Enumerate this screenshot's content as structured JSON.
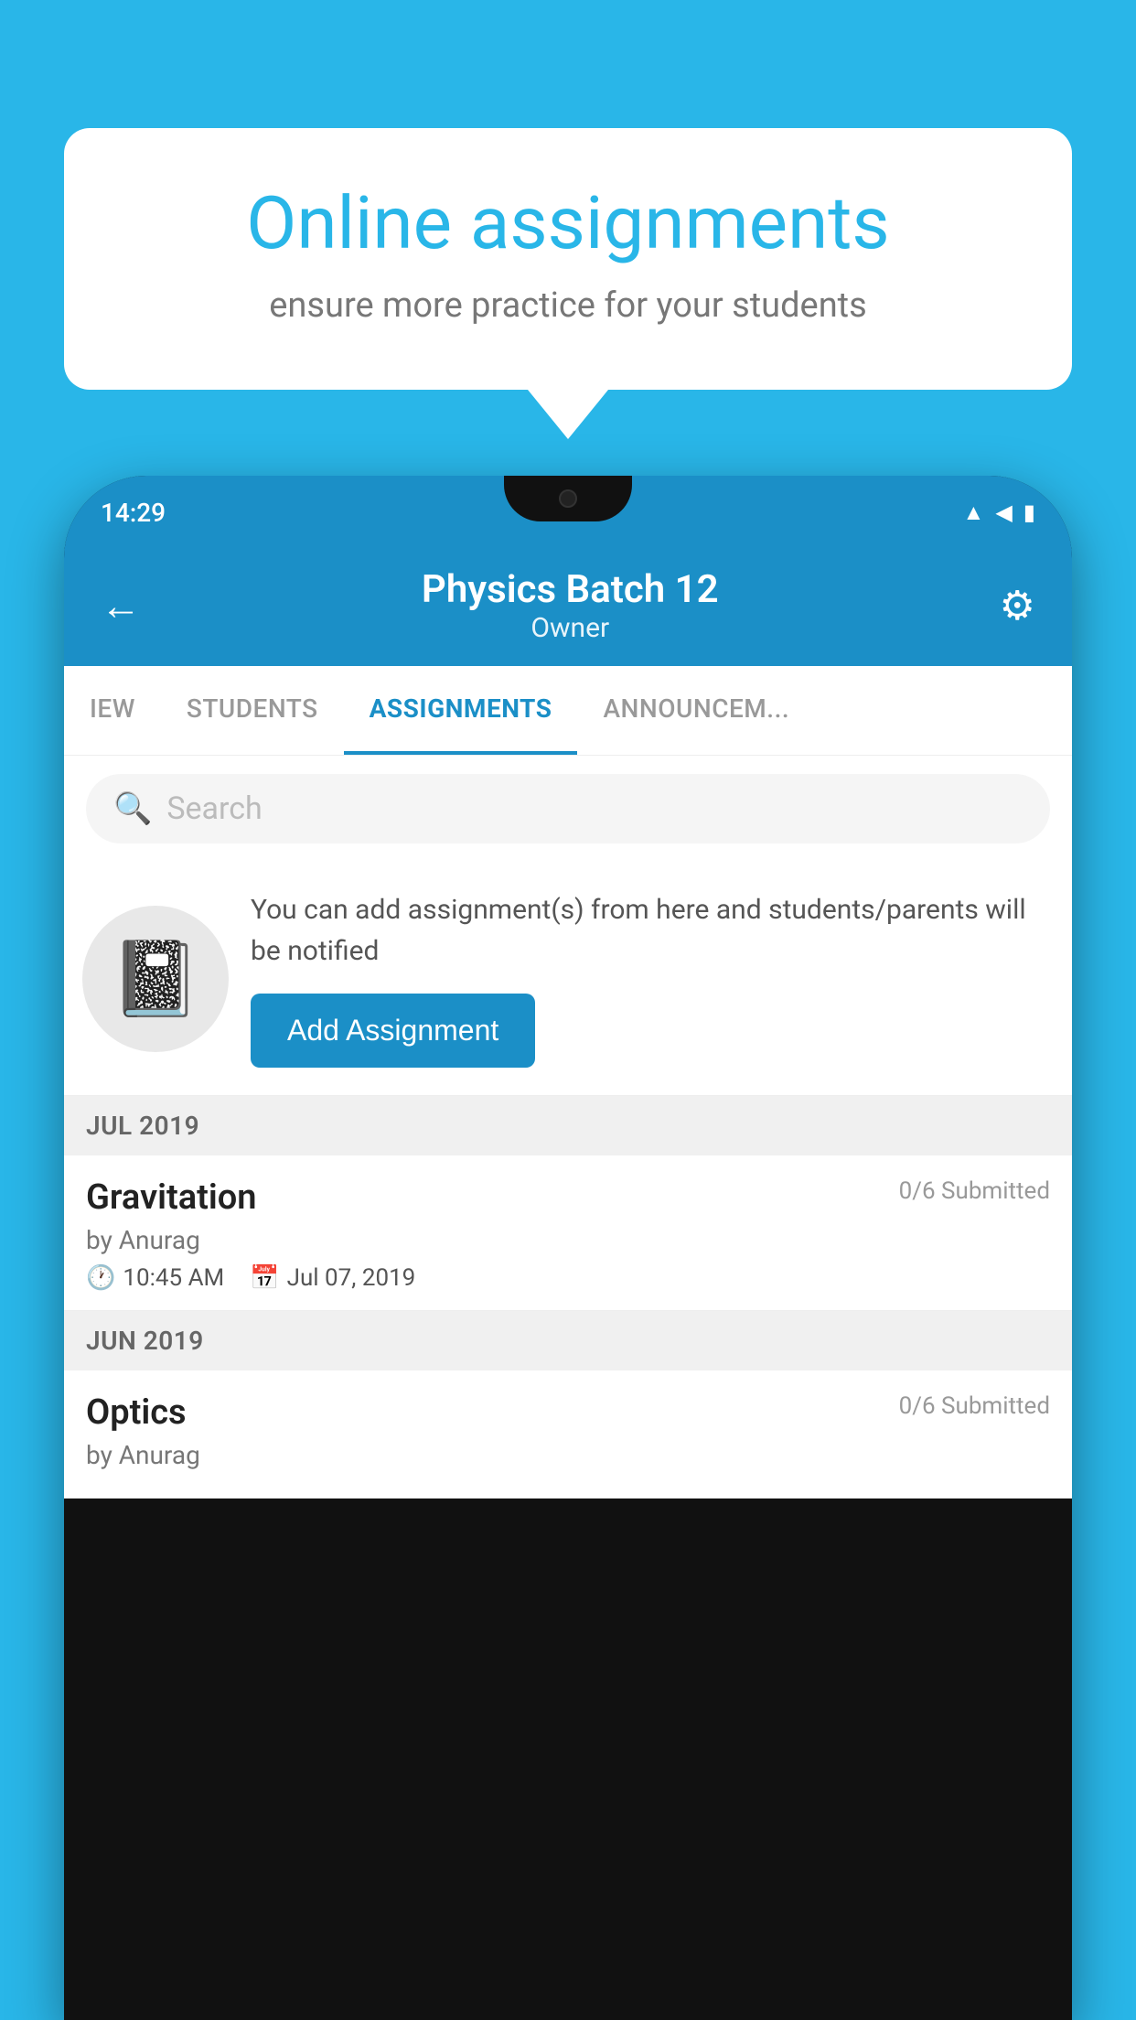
{
  "background_color": "#29b6e8",
  "speech_bubble": {
    "title": "Online assignments",
    "subtitle": "ensure more practice for your students"
  },
  "phone": {
    "status_bar": {
      "time": "14:29",
      "wifi_icon": "wifi",
      "signal_icon": "signal",
      "battery_icon": "battery"
    },
    "header": {
      "back_label": "←",
      "title": "Physics Batch 12",
      "subtitle": "Owner",
      "settings_icon": "⚙"
    },
    "tabs": [
      {
        "label": "IEW",
        "active": false
      },
      {
        "label": "STUDENTS",
        "active": false
      },
      {
        "label": "ASSIGNMENTS",
        "active": true
      },
      {
        "label": "ANNOUNCEM...",
        "active": false
      }
    ],
    "search": {
      "placeholder": "Search"
    },
    "promo": {
      "description": "You can add assignment(s) from here and students/parents will be notified",
      "button_label": "Add Assignment"
    },
    "month_groups": [
      {
        "month": "JUL 2019",
        "assignments": [
          {
            "name": "Gravitation",
            "submitted": "0/6 Submitted",
            "by": "by Anurag",
            "time": "10:45 AM",
            "date": "Jul 07, 2019"
          }
        ]
      },
      {
        "month": "JUN 2019",
        "assignments": [
          {
            "name": "Optics",
            "submitted": "0/6 Submitted",
            "by": "by Anurag",
            "time": "",
            "date": ""
          }
        ]
      }
    ]
  }
}
